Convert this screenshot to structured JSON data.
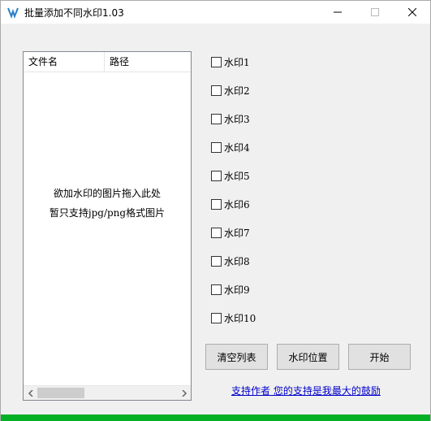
{
  "window": {
    "title": "批量添加不同水印1.03"
  },
  "file_list": {
    "columns": [
      "文件名",
      "路径"
    ],
    "drop_hint_line1": "欲加水印的图片拖入此处",
    "drop_hint_line2": "暂只支持jpg/png格式图片"
  },
  "watermarks": [
    {
      "label": "水印1",
      "checked": false
    },
    {
      "label": "水印2",
      "checked": false
    },
    {
      "label": "水印3",
      "checked": false
    },
    {
      "label": "水印4",
      "checked": false
    },
    {
      "label": "水印5",
      "checked": false
    },
    {
      "label": "水印6",
      "checked": false
    },
    {
      "label": "水印7",
      "checked": false
    },
    {
      "label": "水印8",
      "checked": false
    },
    {
      "label": "水印9",
      "checked": false
    },
    {
      "label": "水印10",
      "checked": false
    }
  ],
  "buttons": {
    "clear_list": "清空列表",
    "watermark_position": "水印位置",
    "start": "开始"
  },
  "support_link": "支持作者  您的支持是我最大的鼓励",
  "progress": {
    "value_percent": 100,
    "color": "#06b025"
  },
  "colors": {
    "link": "#0000cc"
  }
}
